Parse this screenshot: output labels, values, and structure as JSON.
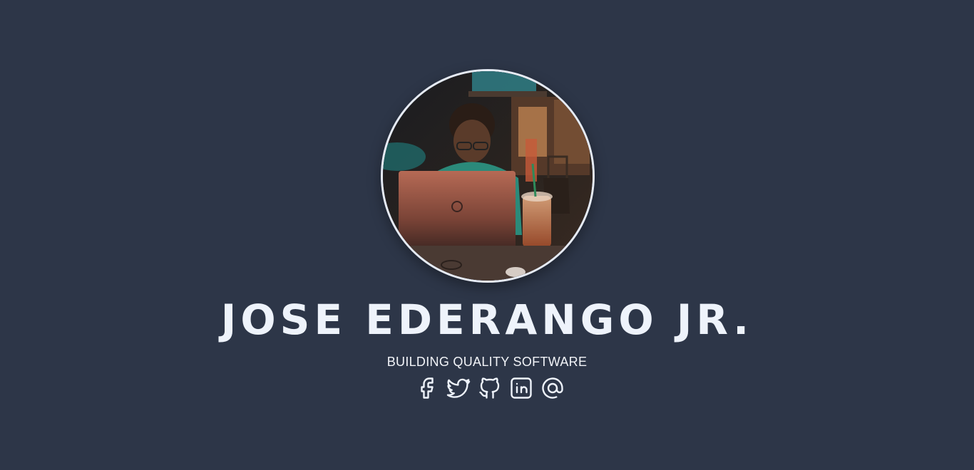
{
  "profile": {
    "name": "JOSE EDERANGO JR.",
    "tagline": "BUILDING QUALITY SOFTWARE"
  },
  "socials": [
    {
      "icon": "facebook-icon"
    },
    {
      "icon": "twitter-icon"
    },
    {
      "icon": "github-icon"
    },
    {
      "icon": "linkedin-icon"
    },
    {
      "icon": "at-sign-icon"
    }
  ],
  "colors": {
    "background": "#2d3648",
    "text": "#eef3fb",
    "avatar_border": "#e6ebf5"
  }
}
